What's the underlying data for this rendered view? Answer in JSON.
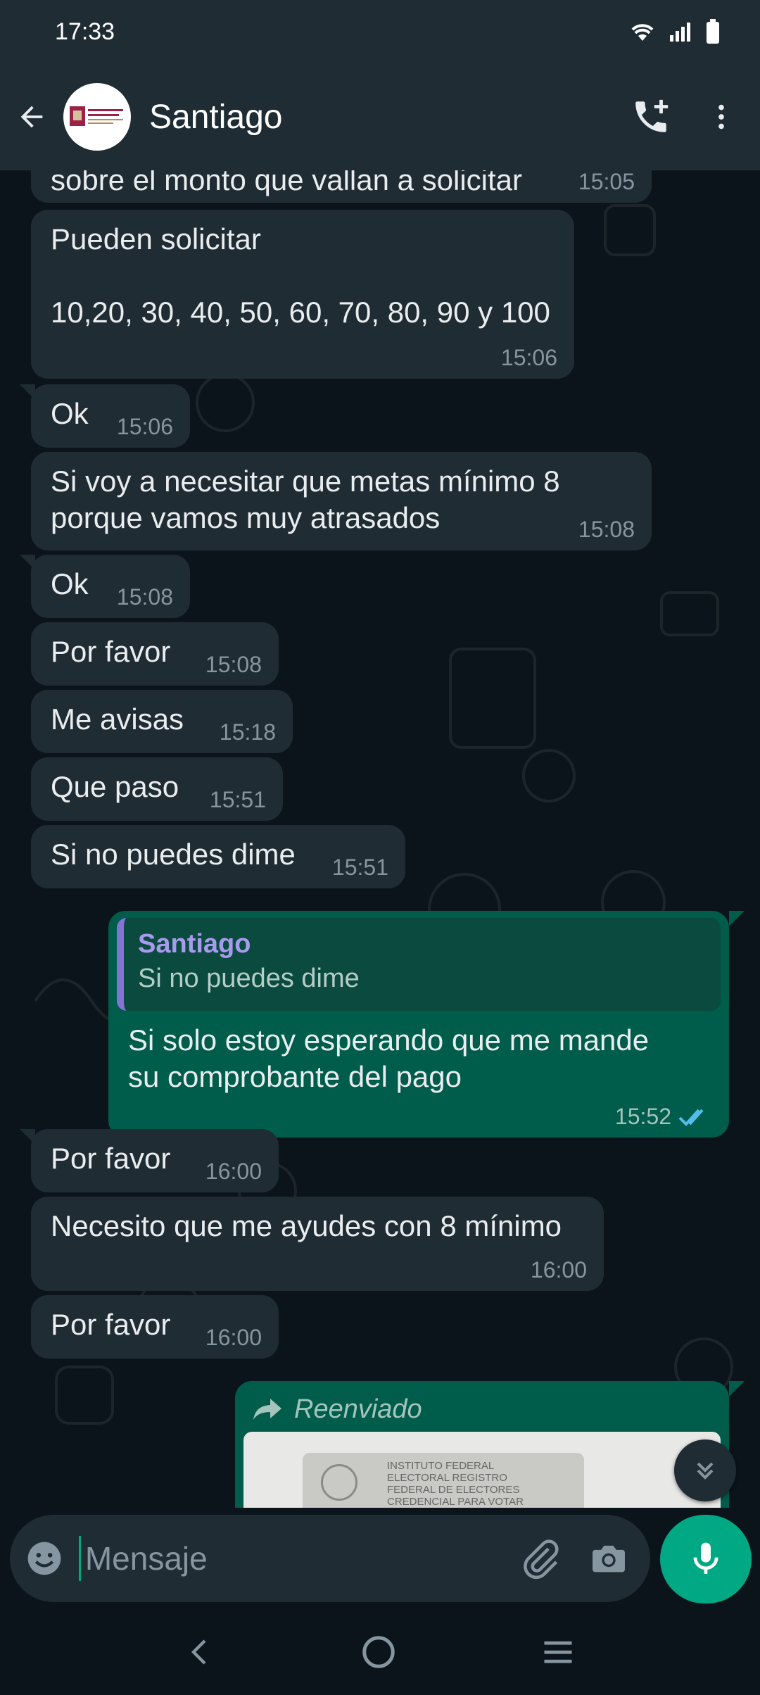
{
  "status_bar": {
    "time": "17:33"
  },
  "header": {
    "contact_name": "Santiago"
  },
  "messages": [
    {
      "dir": "in",
      "text": "sobre el monto que vallan a solicitar",
      "time": "15:05"
    },
    {
      "dir": "in",
      "text": "Pueden solicitar\n\n10,20, 30, 40, 50, 60, 70, 80, 90 y 100",
      "time": "15:06"
    },
    {
      "dir": "in",
      "text": "Ok",
      "time": "15:06"
    },
    {
      "dir": "in",
      "text": "Si voy a necesitar que metas mínimo 8 porque vamos muy atrasados",
      "time": "15:08"
    },
    {
      "dir": "in",
      "text": "Ok",
      "time": "15:08"
    },
    {
      "dir": "in",
      "text": "Por favor",
      "time": "15:08"
    },
    {
      "dir": "in",
      "text": "Me avisas",
      "time": "15:18"
    },
    {
      "dir": "in",
      "text": "Que paso",
      "time": "15:51"
    },
    {
      "dir": "in",
      "text": "Si no puedes dime",
      "time": "15:51"
    },
    {
      "dir": "out",
      "quote_name": "Santiago",
      "quote_text": "Si no puedes dime",
      "text": "Si solo estoy esperando que me mande su comprobante del pago",
      "time": "15:52"
    },
    {
      "dir": "in",
      "text": "Por favor",
      "time": "16:00"
    },
    {
      "dir": "in",
      "text": "Necesito que me ayudes con 8 mínimo",
      "time": "16:00"
    },
    {
      "dir": "in",
      "text": "Por favor",
      "time": "16:00"
    },
    {
      "dir": "out",
      "forwarded_label": "Reenviado",
      "image_caption": "INSTITUTO FEDERAL ELECTORAL REGISTRO FEDERAL DE ELECTORES CREDENCIAL PARA VOTAR"
    }
  ],
  "input": {
    "placeholder": "Mensaje"
  },
  "colors": {
    "accent": "#00a884",
    "outgoing": "#005c4b",
    "incoming": "#202c33",
    "header": "#1f2c34",
    "tick_read": "#53bdeb"
  }
}
